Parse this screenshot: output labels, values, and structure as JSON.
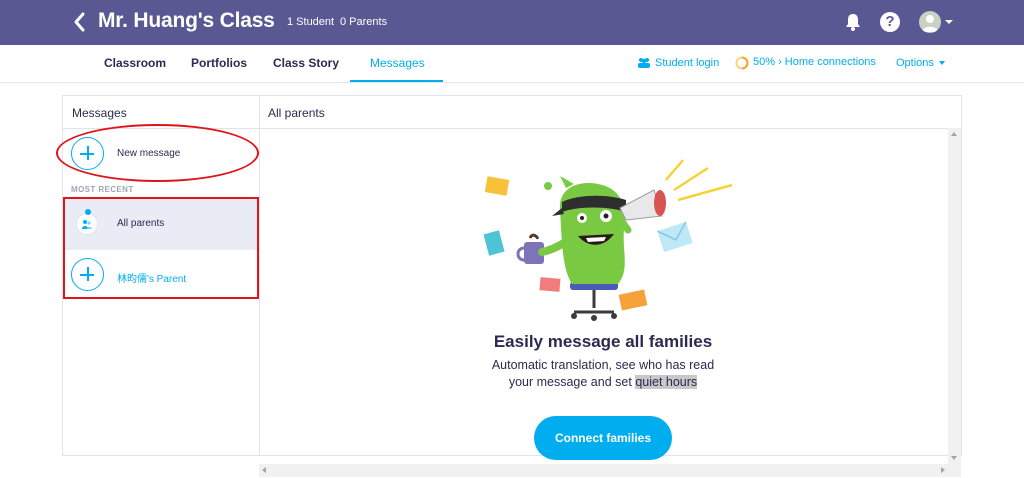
{
  "header": {
    "class_title": "Mr. Huang's Class",
    "student_count": "1 Student",
    "parent_count": "0 Parents",
    "icons": [
      "back-arrow-icon",
      "bell-icon",
      "help-icon",
      "avatar",
      "chevron-down-icon"
    ]
  },
  "nav": {
    "tabs": [
      {
        "label": "Classroom",
        "active": false
      },
      {
        "label": "Portfolios",
        "active": false
      },
      {
        "label": "Class Story",
        "active": false
      },
      {
        "label": "Messages",
        "active": true
      }
    ],
    "student_login": "Student login",
    "home_connections": "50% › Home connections",
    "home_connections_progress": 0.5,
    "options": "Options"
  },
  "sidebar": {
    "title": "Messages",
    "new_message": "New message",
    "section_label": "MOST RECENT",
    "conversations": [
      {
        "label": "All parents",
        "selected": true
      },
      {
        "label": "林昀儒's Parent",
        "selected": false
      }
    ]
  },
  "main": {
    "title": "All parents",
    "empty_title": "Easily message all families",
    "empty_desc_1": "Automatic translation, see who has read your message and set",
    "empty_desc_highlight": "quiet hours",
    "connect_button": "Connect families"
  },
  "colors": {
    "header_bg": "#5a5893",
    "accent": "#00aeef",
    "annotation": "#e0151c",
    "selected_row": "#eaecf5"
  }
}
